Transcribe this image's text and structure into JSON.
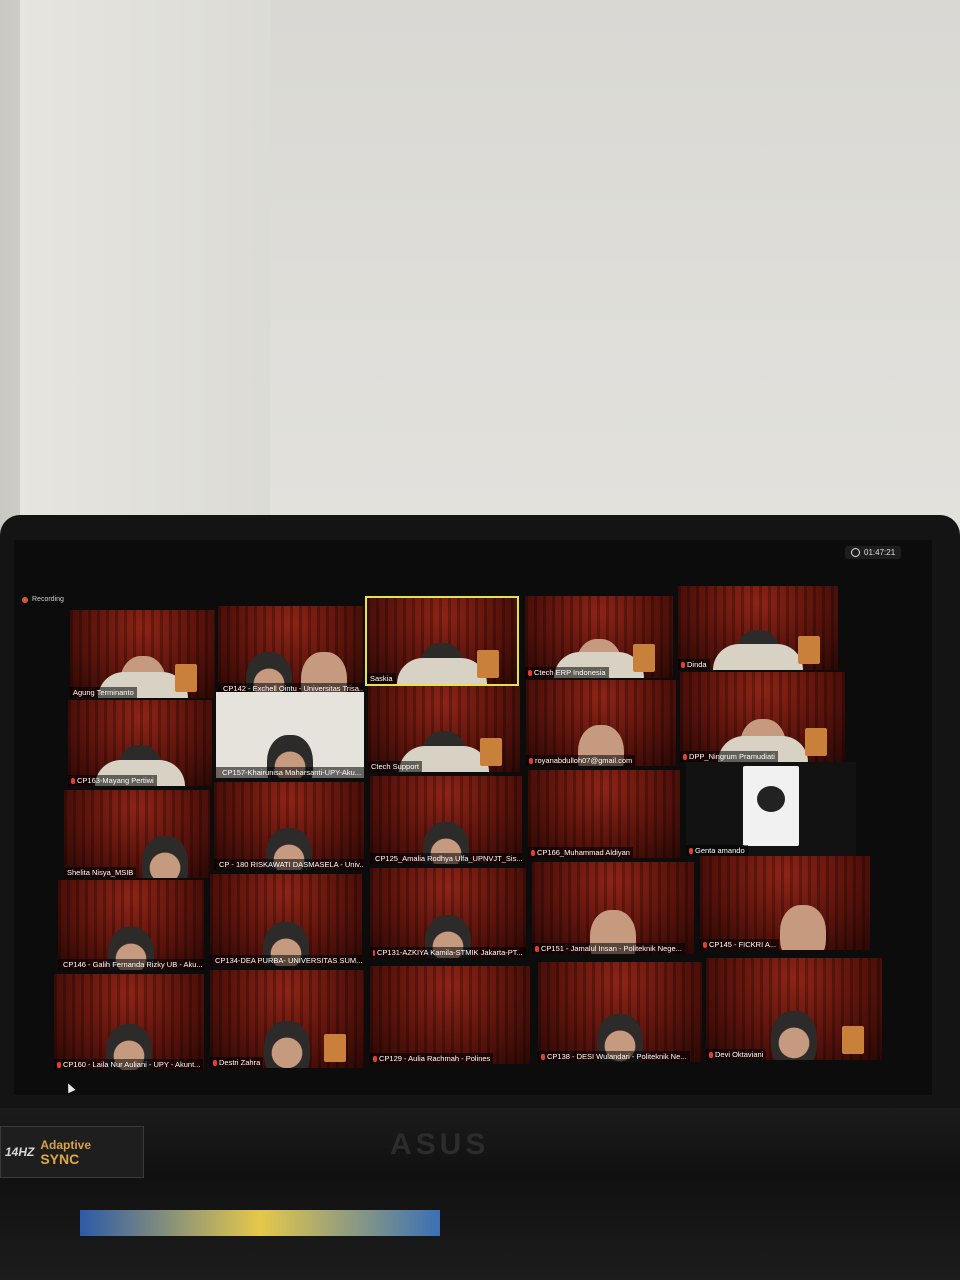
{
  "app": {
    "recording_label": "Recording",
    "timer": "01:47:21",
    "device": {
      "brand": "ASUS",
      "badge_hz": "14HZ",
      "badge_line1": "Adaptive",
      "badge_line2": "SYNC"
    }
  },
  "participants": [
    {
      "name": "Agung Terminanto"
    },
    {
      "name": "CP142 - Exchell Ointu - Universitas Trisa..."
    },
    {
      "name": "Saskia"
    },
    {
      "name": "Ctech ERP Indonesia"
    },
    {
      "name": "Dinda"
    },
    {
      "name": "CP163-Mayang Pertiwi"
    },
    {
      "name": "CP157-Khairunisa Maharsanti-UPY-Aku..."
    },
    {
      "name": "Ctech Support"
    },
    {
      "name": "royanabdulloh07@gmail.com"
    },
    {
      "name": "DPP_Ningrum Pramudiati"
    },
    {
      "name": "Shelita Nisya_MSIB"
    },
    {
      "name": "CP - 180 RISKAWATI DASMASELA - Univ..."
    },
    {
      "name": "CP125_Amalia Rodhya Ulfa_UPNVJT_Sis..."
    },
    {
      "name": "CP166_Muhammad Aldiyan"
    },
    {
      "name": "Genta amando"
    },
    {
      "name": "CP146 - Galih Fernanda Rizky UB - Aku..."
    },
    {
      "name": "CP134-DEA PURBA- UNIVERSITAS SUM..."
    },
    {
      "name": "CP131-AZKIYA Kamila-STMIK Jakarta-PT..."
    },
    {
      "name": "CP151 - Jamalul Insan - Politeknik Nege..."
    },
    {
      "name": "CP145 - FICKRI A..."
    },
    {
      "name": "CP160 - Laila Nur Auliani - UPY - Akunt..."
    },
    {
      "name": "Destri Zahra"
    },
    {
      "name": "CP129 - Aulia Rachmah - Polines"
    },
    {
      "name": "CP138 - DESI Wulandari - Politeknik Ne..."
    },
    {
      "name": "Devi Oktaviani"
    }
  ]
}
